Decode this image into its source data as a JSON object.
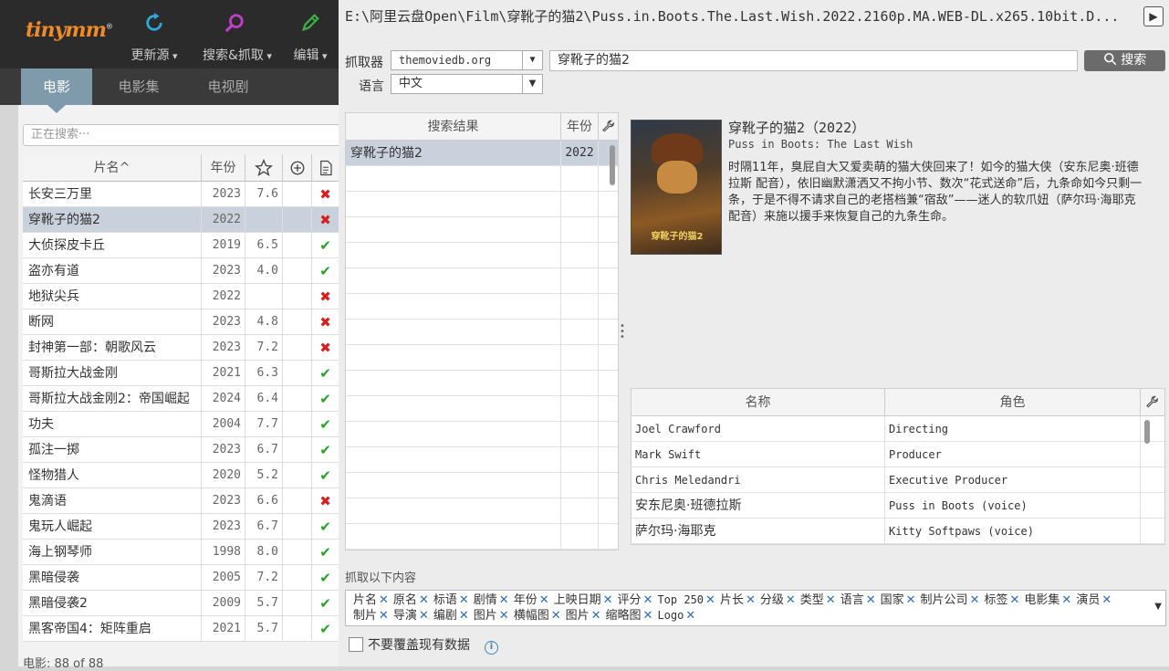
{
  "app": {
    "logo": "tinymm"
  },
  "toolbar": [
    {
      "label": "更新源",
      "icon": "refresh-icon"
    },
    {
      "label": "搜索&抓取",
      "icon": "search-icon"
    },
    {
      "label": "编辑",
      "icon": "pencil-icon"
    }
  ],
  "tabs": [
    "电影",
    "电影集",
    "电视剧"
  ],
  "filter_placeholder": "正在搜索···",
  "movie_table": {
    "headers": {
      "title": "片名^",
      "year": "年份"
    },
    "rows": [
      {
        "title": "长安三万里",
        "year": "2023",
        "rating": "7.6",
        "scraped": false
      },
      {
        "title": "穿靴子的猫2",
        "year": "2022",
        "rating": "",
        "scraped": false,
        "selected": true
      },
      {
        "title": "大侦探皮卡丘",
        "year": "2019",
        "rating": "6.5",
        "scraped": true
      },
      {
        "title": "盗亦有道",
        "year": "2023",
        "rating": "4.0",
        "scraped": true
      },
      {
        "title": "地狱尖兵",
        "year": "2022",
        "rating": "",
        "scraped": false
      },
      {
        "title": "断网",
        "year": "2023",
        "rating": "4.8",
        "scraped": false
      },
      {
        "title": "封神第一部：朝歌风云",
        "year": "2023",
        "rating": "7.2",
        "scraped": false
      },
      {
        "title": "哥斯拉大战金刚",
        "year": "2021",
        "rating": "6.3",
        "scraped": true
      },
      {
        "title": "哥斯拉大战金刚2：帝国崛起",
        "year": "2024",
        "rating": "6.4",
        "scraped": true
      },
      {
        "title": "功夫",
        "year": "2004",
        "rating": "7.7",
        "scraped": true
      },
      {
        "title": "孤注一掷",
        "year": "2023",
        "rating": "6.7",
        "scraped": true
      },
      {
        "title": "怪物猎人",
        "year": "2020",
        "rating": "5.2",
        "scraped": true
      },
      {
        "title": "鬼滴语",
        "year": "2023",
        "rating": "6.6",
        "scraped": false
      },
      {
        "title": "鬼玩人崛起",
        "year": "2023",
        "rating": "6.7",
        "scraped": true
      },
      {
        "title": "海上钢琴师",
        "year": "1998",
        "rating": "8.0",
        "scraped": true
      },
      {
        "title": "黑暗侵袭",
        "year": "2005",
        "rating": "7.2",
        "scraped": true
      },
      {
        "title": "黑暗侵袭2",
        "year": "2009",
        "rating": "5.7",
        "scraped": true
      },
      {
        "title": "黑客帝国4：矩阵重启",
        "year": "2021",
        "rating": "5.7",
        "scraped": true
      }
    ]
  },
  "movie_status": "电影: 88 of 88",
  "file_path": "E:\\阿里云盘Open\\Film\\穿靴子的猫2\\Puss.in.Boots.The.Last.Wish.2022.2160p.MA.WEB-DL.x265.10bit.D...",
  "scraper": {
    "label": "抓取器",
    "value": "themoviedb.org"
  },
  "language": {
    "label": "语言",
    "value": "中文"
  },
  "search_query": "穿靴子的猫2",
  "search_button": "搜索",
  "results": {
    "headers": {
      "title": "搜索结果",
      "year": "年份"
    },
    "rows": [
      {
        "title": "穿靴子的猫2",
        "year": "2022"
      }
    ]
  },
  "detail": {
    "title": "穿靴子的猫2（2022）",
    "original_title": "Puss in Boots: The Last Wish",
    "plot": "时隔11年，臭屁自大又爱卖萌的猫大侠回来了！如今的猫大侠（安东尼奥·班德拉斯 配音），依旧幽默潇洒又不拘小节、数次“花式送命”后，九条命如今只剩一条，于是不得不请求自己的老搭档兼“宿敌”——迷人的软爪妞（萨尔玛·海耶克 配音）来施以援手来恢复自己的九条生命。",
    "poster_text": "穿靴子的猫2"
  },
  "crew": {
    "headers": {
      "name": "名称",
      "role": "角色"
    },
    "rows": [
      {
        "name": "Joel Crawford",
        "role": "Directing"
      },
      {
        "name": "Mark Swift",
        "role": "Producer"
      },
      {
        "name": "Chris Meledandri",
        "role": "Executive Producer"
      },
      {
        "name": "安东尼奥·班德拉斯",
        "role": "Puss in Boots (voice)"
      },
      {
        "name": "萨尔玛·海耶克",
        "role": "Kitty Softpaws (voice)"
      }
    ]
  },
  "scrape_label": "抓取以下内容",
  "scrape_tags": [
    "片名",
    "原名",
    "标语",
    "剧情",
    "年份",
    "上映日期",
    "评分",
    "Top 250",
    "片长",
    "分级",
    "类型",
    "语言",
    "国家",
    "制片公司",
    "标签",
    "电影集",
    "演员",
    "制片",
    "导演",
    "编剧",
    "图片",
    "横幅图",
    "图片",
    "缩略图",
    "Logo"
  ],
  "no_overwrite": "不要覆盖现有数据"
}
